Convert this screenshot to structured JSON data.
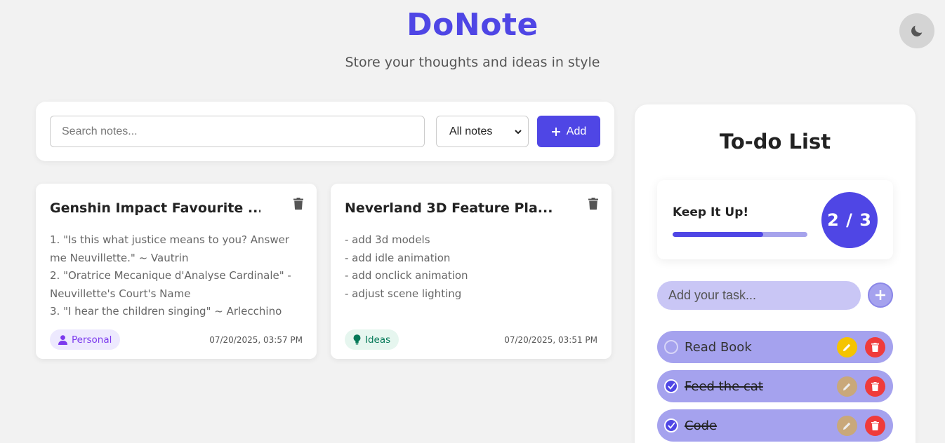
{
  "header": {
    "title": "DoNote",
    "subtitle": "Store your thoughts and ideas in style"
  },
  "theme_toggle": {
    "icon": "moon-icon"
  },
  "toolbar": {
    "search_placeholder": "Search notes...",
    "filter_selected": "All notes",
    "add_label": "Add"
  },
  "notes": [
    {
      "title": "Genshin Impact Favourite ...",
      "lines": [
        "1. \"Is this what justice means to you? Answer",
        "me Neuvillette.\" ~ Vautrin",
        "2. \"Oratrice Mecanique d'Analyse Cardinale\" -",
        "Neuvillette's Court's Name",
        "3. \"I hear the children singing\" ~ Arlecchino"
      ],
      "tag": {
        "label": "Personal",
        "icon": "person-icon",
        "color": "#7c3aed",
        "bg": "#ede9fe"
      },
      "date": "07/20/2025, 03:57 PM"
    },
    {
      "title": "Neverland 3D Feature Pla...",
      "lines": [
        "- add 3d models",
        "- add idle animation",
        "- add onclick animation",
        "- adjust scene lighting"
      ],
      "tag": {
        "label": "Ideas",
        "icon": "lightbulb-icon",
        "color": "#047857",
        "bg": "#e6f6ef"
      },
      "date": "07/20/2025, 03:51 PM"
    }
  ],
  "todo": {
    "heading": "To-do List",
    "progress_label": "Keep It Up!",
    "progress_text": "2 / 3",
    "progress_fraction": 0.67,
    "input_placeholder": "Add your task...",
    "tasks": [
      {
        "label": "Read Book",
        "done": false
      },
      {
        "label": "Feed the cat",
        "done": true
      },
      {
        "label": "Code",
        "done": true
      }
    ]
  },
  "colors": {
    "brand": "#4f46e5",
    "task_bg": "#a5a2ee",
    "edit_active": "#f5c400",
    "edit_disabled": "#c9a87a",
    "delete": "#ef3b3b"
  }
}
